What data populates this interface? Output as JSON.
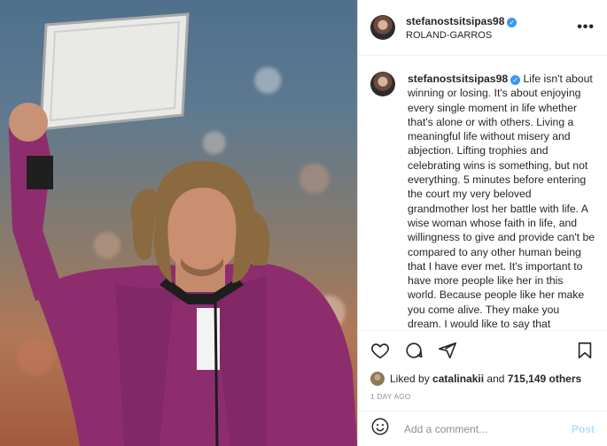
{
  "post": {
    "username": "stefanostsitsipas98",
    "location": "ROLAND-GARROS",
    "more_icon": "more-options-icon",
    "verified_icon": "verified-badge-icon"
  },
  "caption": {
    "username": "stefanostsitsipas98",
    "text": "Life isn't about winning or losing. It's about enjoying every single moment in life whether that's alone or with others. Living a meaningful life without misery and abjection. Lifting trophies and celebrating wins is something, but not everything. 5 minutes before entering the court my very beloved grandmother lost her battle with life. A wise woman whose faith in life, and willingness to give and provide can't be compared to any other human being that I have ever met. It's important to have more people like her in this world. Because people like her make you come alive. They make you dream. I would like to say that regardless of the day, circumstance or"
  },
  "actions": {
    "like_icon": "heart-icon",
    "comment_icon": "comment-icon",
    "share_icon": "share-icon",
    "save_icon": "bookmark-icon"
  },
  "likes": {
    "prefix": "Liked by",
    "liked_by_user": "catalinakii",
    "and_label": "and",
    "count_text": "715,149 others"
  },
  "timestamp": "1 DAY AGO",
  "comment": {
    "placeholder": "Add a comment...",
    "post_label": "Post",
    "emoji_icon": "emoji-icon"
  },
  "colors": {
    "link_blue": "#3897f0",
    "post_disabled": "#b2dffc",
    "jacket_magenta": "#8e2d6e"
  }
}
